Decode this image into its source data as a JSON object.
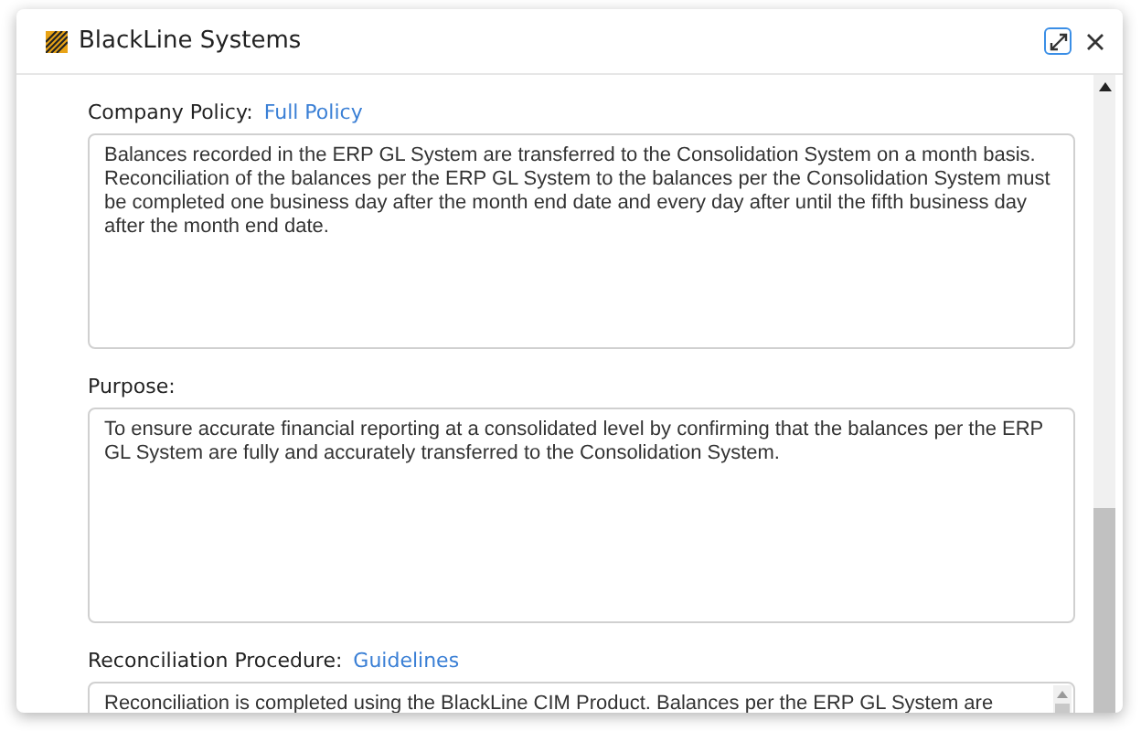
{
  "window": {
    "title": "BlackLine Systems"
  },
  "sections": [
    {
      "label": "Company Policy:",
      "link": "Full Policy",
      "text": "Balances recorded in the ERP GL System are transferred to the Consolidation System on a month basis. Reconciliation of the balances per the ERP GL System to the balances per the Consolidation System must be completed one business day after the month end date and every day after until the fifth business day after the month end date.",
      "cut": false
    },
    {
      "label": "Purpose:",
      "text": "To ensure accurate financial reporting at a consolidated level by confirming that the balances per the ERP GL System are fully and accurately transferred to the Consolidation System.",
      "cut": false
    },
    {
      "label": "Reconciliation Procedure:",
      "link": "Guidelines",
      "text": "Reconciliation is completed using the BlackLine CIM Product.  Balances per the ERP GL System are",
      "cut": true
    }
  ]
}
